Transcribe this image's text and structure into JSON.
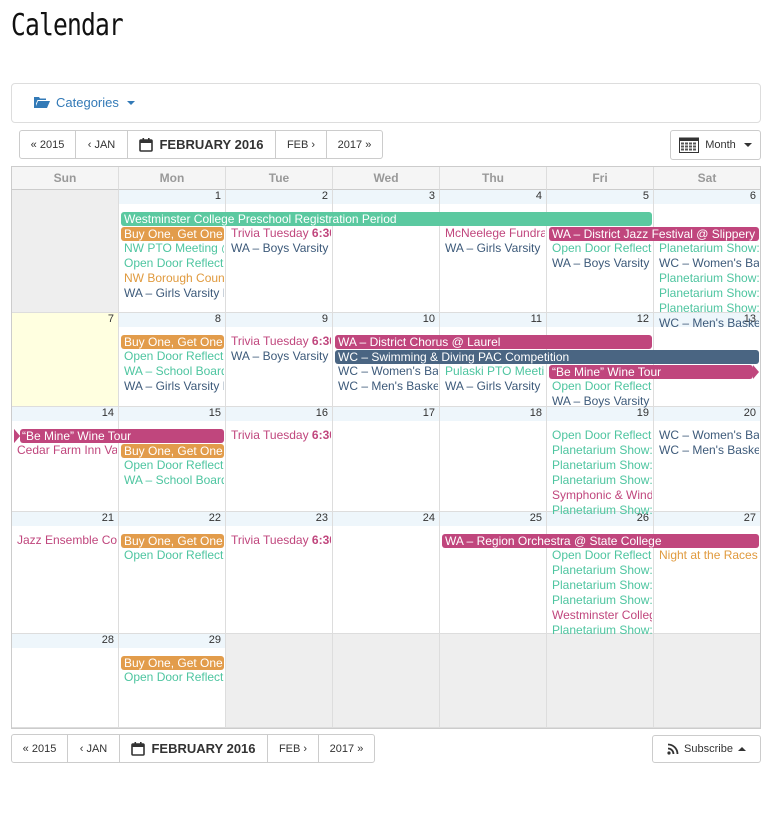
{
  "page": {
    "title": "Calendar"
  },
  "categories": {
    "label": "Categories"
  },
  "nav": {
    "prev_year": "« 2015",
    "prev_month": "‹ JAN",
    "current": "FEBRUARY 2016",
    "next_month": "FEB ›",
    "next_year": "2017 »"
  },
  "view": {
    "label": "Month"
  },
  "subscribe": {
    "label": "Subscribe"
  },
  "colors": {
    "green": "#5bc9a0",
    "orange": "#e29c4b",
    "pink": "#c0467d",
    "navy": "#4a6582",
    "teal_text": "#4ec5a0",
    "pink_text": "#c0467d",
    "orange_text": "#e09a3e",
    "navy_text": "#3d5a7a"
  },
  "weekdays": [
    "Sun",
    "Mon",
    "Tue",
    "Wed",
    "Thu",
    "Fri",
    "Sat"
  ],
  "weeks": [
    [
      {
        "d": ""
      },
      {
        "d": "1"
      },
      {
        "d": "2"
      },
      {
        "d": "3"
      },
      {
        "d": "4"
      },
      {
        "d": "5"
      },
      {
        "d": "6"
      }
    ],
    [
      {
        "d": "7",
        "today": true
      },
      {
        "d": "8"
      },
      {
        "d": "9"
      },
      {
        "d": "10"
      },
      {
        "d": "11"
      },
      {
        "d": "12"
      },
      {
        "d": "13"
      }
    ],
    [
      {
        "d": "14"
      },
      {
        "d": "15"
      },
      {
        "d": "16"
      },
      {
        "d": "17"
      },
      {
        "d": "18"
      },
      {
        "d": "19"
      },
      {
        "d": "20"
      }
    ],
    [
      {
        "d": "21"
      },
      {
        "d": "22"
      },
      {
        "d": "23"
      },
      {
        "d": "24"
      },
      {
        "d": "25"
      },
      {
        "d": "26"
      },
      {
        "d": "27"
      }
    ],
    [
      {
        "d": "28"
      },
      {
        "d": "29"
      },
      {
        "d": "",
        "blank": true
      },
      {
        "d": "",
        "blank": true
      },
      {
        "d": "",
        "blank": true
      },
      {
        "d": "",
        "blank": true
      },
      {
        "d": "",
        "blank": true
      }
    ]
  ],
  "events": [
    {
      "w": 0,
      "c": 1,
      "span": 5,
      "slot": 0,
      "type": "bar",
      "color": "green",
      "text": "Westminster College Preschool Registration Period"
    },
    {
      "w": 0,
      "c": 1,
      "slot": 1,
      "type": "bar",
      "color": "orange",
      "text": "Buy One, Get One"
    },
    {
      "w": 0,
      "c": 1,
      "slot": 2,
      "type": "text",
      "color": "teal_text",
      "text": "NW PTO Meeting @"
    },
    {
      "w": 0,
      "c": 1,
      "slot": 3,
      "type": "text",
      "color": "teal_text",
      "text": "Open Door Reflect"
    },
    {
      "w": 0,
      "c": 1,
      "slot": 4,
      "type": "text",
      "color": "orange_text",
      "text": "NW Borough Coun"
    },
    {
      "w": 0,
      "c": 1,
      "slot": 5,
      "type": "text",
      "color": "navy_text",
      "text": "WA – Girls Varsity I"
    },
    {
      "w": 0,
      "c": 2,
      "slot": 1,
      "type": "text",
      "color": "pink_text",
      "text": "Trivia Tuesday",
      "time": "6:30"
    },
    {
      "w": 0,
      "c": 2,
      "slot": 2,
      "type": "text",
      "color": "navy_text",
      "text": "WA – Boys Varsity"
    },
    {
      "w": 0,
      "c": 4,
      "slot": 1,
      "type": "text",
      "color": "pink_text",
      "text": "McNeelege Fundra"
    },
    {
      "w": 0,
      "c": 4,
      "slot": 2,
      "type": "text",
      "color": "navy_text",
      "text": "WA – Girls Varsity"
    },
    {
      "w": 0,
      "c": 5,
      "span": 2,
      "slot": 1,
      "type": "bar",
      "color": "pink",
      "text": "WA – District Jazz Festival @ Slippery Rock"
    },
    {
      "w": 0,
      "c": 5,
      "slot": 2,
      "type": "text",
      "color": "teal_text",
      "text": "Open Door Reflect"
    },
    {
      "w": 0,
      "c": 5,
      "slot": 3,
      "type": "text",
      "color": "navy_text",
      "text": "WA – Boys Varsity"
    },
    {
      "w": 0,
      "c": 6,
      "slot": 2,
      "type": "text",
      "color": "teal_text",
      "text": "Planetarium Show:"
    },
    {
      "w": 0,
      "c": 6,
      "slot": 3,
      "type": "text",
      "color": "navy_text",
      "text": "WC – Women's Ba"
    },
    {
      "w": 0,
      "c": 6,
      "slot": 4,
      "type": "text",
      "color": "teal_text",
      "text": "Planetarium Show:"
    },
    {
      "w": 0,
      "c": 6,
      "slot": 5,
      "type": "text",
      "color": "teal_text",
      "text": "Planetarium Show:"
    },
    {
      "w": 0,
      "c": 6,
      "slot": 6,
      "type": "text",
      "color": "teal_text",
      "text": "Planetarium Show:"
    },
    {
      "w": 0,
      "c": 6,
      "slot": 7,
      "type": "text",
      "color": "navy_text",
      "text": "WC – Men's Baske"
    },
    {
      "w": 1,
      "c": 1,
      "slot": 0,
      "type": "bar",
      "color": "orange",
      "text": "Buy One, Get One"
    },
    {
      "w": 1,
      "c": 1,
      "slot": 1,
      "type": "text",
      "color": "teal_text",
      "text": "Open Door Reflect"
    },
    {
      "w": 1,
      "c": 1,
      "slot": 2,
      "type": "text",
      "color": "teal_text",
      "text": "WA – School Board"
    },
    {
      "w": 1,
      "c": 1,
      "slot": 3,
      "type": "text",
      "color": "navy_text",
      "text": "WA – Girls Varsity I"
    },
    {
      "w": 1,
      "c": 2,
      "slot": 0,
      "type": "text",
      "color": "pink_text",
      "text": "Trivia Tuesday",
      "time": "6:30"
    },
    {
      "w": 1,
      "c": 2,
      "slot": 1,
      "type": "text",
      "color": "navy_text",
      "text": "WA – Boys Varsity"
    },
    {
      "w": 1,
      "c": 3,
      "span": 3,
      "slot": 0,
      "type": "bar",
      "color": "pink",
      "text": "WA – District Chorus @ Laurel"
    },
    {
      "w": 1,
      "c": 3,
      "span": 4,
      "slot": 1,
      "type": "bar",
      "color": "navy",
      "text": "WC – Swimming & Diving PAC Competition"
    },
    {
      "w": 1,
      "c": 3,
      "slot": 2,
      "type": "text",
      "color": "navy_text",
      "text": "WC – Women's Ba"
    },
    {
      "w": 1,
      "c": 3,
      "slot": 3,
      "type": "text",
      "color": "navy_text",
      "text": "WC – Men's Baske"
    },
    {
      "w": 1,
      "c": 4,
      "slot": 2,
      "type": "text",
      "color": "teal_text",
      "text": "Pulaski PTO Meeti"
    },
    {
      "w": 1,
      "c": 4,
      "slot": 3,
      "type": "text",
      "color": "navy_text",
      "text": "WA – Girls Varsity"
    },
    {
      "w": 1,
      "c": 5,
      "span": 2,
      "slot": 2,
      "type": "bar",
      "color": "pink",
      "arrow": "right",
      "text": "“Be Mine” Wine Tour"
    },
    {
      "w": 1,
      "c": 5,
      "slot": 3,
      "type": "text",
      "color": "teal_text",
      "text": "Open Door Reflect"
    },
    {
      "w": 1,
      "c": 5,
      "slot": 4,
      "type": "text",
      "color": "navy_text",
      "text": "WA – Boys Varsity"
    },
    {
      "w": 2,
      "c": 0,
      "span": 2,
      "slot": 0,
      "type": "bar",
      "color": "pink",
      "arrow": "left",
      "text": "“Be Mine” Wine Tour"
    },
    {
      "w": 2,
      "c": 0,
      "slot": 1,
      "type": "text",
      "color": "pink_text",
      "text": "Cedar Farm Inn Va"
    },
    {
      "w": 2,
      "c": 1,
      "slot": 1,
      "type": "bar",
      "color": "orange",
      "text": "Buy One, Get One"
    },
    {
      "w": 2,
      "c": 1,
      "slot": 2,
      "type": "text",
      "color": "teal_text",
      "text": "Open Door Reflect"
    },
    {
      "w": 2,
      "c": 1,
      "slot": 3,
      "type": "text",
      "color": "teal_text",
      "text": "WA – School Board"
    },
    {
      "w": 2,
      "c": 2,
      "slot": 0,
      "type": "text",
      "color": "pink_text",
      "text": "Trivia Tuesday",
      "time": "6:30"
    },
    {
      "w": 2,
      "c": 5,
      "slot": 0,
      "type": "text",
      "color": "teal_text",
      "text": "Open Door Reflect"
    },
    {
      "w": 2,
      "c": 5,
      "slot": 1,
      "type": "text",
      "color": "teal_text",
      "text": "Planetarium Show:"
    },
    {
      "w": 2,
      "c": 5,
      "slot": 2,
      "type": "text",
      "color": "teal_text",
      "text": "Planetarium Show:"
    },
    {
      "w": 2,
      "c": 5,
      "slot": 3,
      "type": "text",
      "color": "teal_text",
      "text": "Planetarium Show:"
    },
    {
      "w": 2,
      "c": 5,
      "slot": 4,
      "type": "text",
      "color": "pink_text",
      "text": "Symphonic & Wind"
    },
    {
      "w": 2,
      "c": 5,
      "slot": 5,
      "type": "text",
      "color": "teal_text",
      "text": "Planetarium Show:"
    },
    {
      "w": 2,
      "c": 6,
      "slot": 0,
      "type": "text",
      "color": "navy_text",
      "text": "WC – Women's Ba"
    },
    {
      "w": 2,
      "c": 6,
      "slot": 1,
      "type": "text",
      "color": "navy_text",
      "text": "WC – Men's Baske"
    },
    {
      "w": 3,
      "c": 0,
      "slot": 0,
      "type": "text",
      "color": "pink_text",
      "text": "Jazz Ensemble Co"
    },
    {
      "w": 3,
      "c": 1,
      "slot": 0,
      "type": "bar",
      "color": "orange",
      "text": "Buy One, Get One"
    },
    {
      "w": 3,
      "c": 1,
      "slot": 1,
      "type": "text",
      "color": "teal_text",
      "text": "Open Door Reflect"
    },
    {
      "w": 3,
      "c": 2,
      "slot": 0,
      "type": "text",
      "color": "pink_text",
      "text": "Trivia Tuesday",
      "time": "6:30"
    },
    {
      "w": 3,
      "c": 4,
      "span": 3,
      "slot": 0,
      "type": "bar",
      "color": "pink",
      "text": "WA – Region Orchestra @ State College"
    },
    {
      "w": 3,
      "c": 5,
      "slot": 1,
      "type": "text",
      "color": "teal_text",
      "text": "Open Door Reflect"
    },
    {
      "w": 3,
      "c": 5,
      "slot": 2,
      "type": "text",
      "color": "teal_text",
      "text": "Planetarium Show:"
    },
    {
      "w": 3,
      "c": 5,
      "slot": 3,
      "type": "text",
      "color": "teal_text",
      "text": "Planetarium Show:"
    },
    {
      "w": 3,
      "c": 5,
      "slot": 4,
      "type": "text",
      "color": "teal_text",
      "text": "Planetarium Show:"
    },
    {
      "w": 3,
      "c": 5,
      "slot": 5,
      "type": "text",
      "color": "pink_text",
      "text": "Westminster Colleg"
    },
    {
      "w": 3,
      "c": 5,
      "slot": 6,
      "type": "text",
      "color": "teal_text",
      "text": "Planetarium Show:"
    },
    {
      "w": 3,
      "c": 6,
      "slot": 1,
      "type": "text",
      "color": "orange_text",
      "text": "Night at the Races"
    },
    {
      "w": 4,
      "c": 1,
      "slot": 0,
      "type": "bar",
      "color": "orange",
      "text": "Buy One, Get One"
    },
    {
      "w": 4,
      "c": 1,
      "slot": 1,
      "type": "text",
      "color": "teal_text",
      "text": "Open Door Reflect"
    }
  ]
}
